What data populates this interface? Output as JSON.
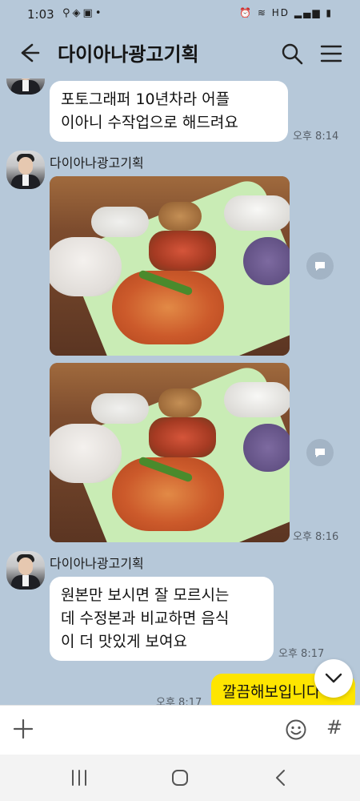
{
  "status_bar": {
    "time": "1:03",
    "left_icons": [
      "location-pin-icon",
      "shield-icon",
      "instagram-icon",
      "dot-icon"
    ],
    "right_icons_text": "HD"
  },
  "header": {
    "title": "다이아나광고기획",
    "icons": [
      "back-arrow-icon",
      "search-icon",
      "hamburger-menu-icon"
    ]
  },
  "messages": {
    "m1": {
      "text": "포토그래퍼 10년차라 어플\n이아니 수작업으로 해드려요",
      "time": "오후 8:14"
    },
    "m2": {
      "sender": "다이아나광고기획",
      "images": [
        "pasta-meal-photo-1",
        "pasta-meal-photo-2"
      ],
      "time": "오후 8:16"
    },
    "m3": {
      "sender": "다이아나광고기획",
      "text": "원본만 보시면 잘 모르시는\n데 수정본과 비교하면 음식\n이 더 맛있게 보여요",
      "time": "오후 8:17"
    },
    "m4": {
      "text": "깔끔해보입니다",
      "time": "오후 8:17",
      "mine": true
    }
  },
  "composer": {
    "placeholder": "",
    "icons": [
      "plus-icon",
      "emoji-icon",
      "hash-icon"
    ]
  },
  "colors": {
    "chat_bg": "#b6c8d9",
    "my_bubble": "#fee500",
    "other_bubble": "#ffffff"
  },
  "nav_bar": {
    "icons": [
      "recent-apps-icon",
      "home-icon",
      "back-icon"
    ]
  }
}
